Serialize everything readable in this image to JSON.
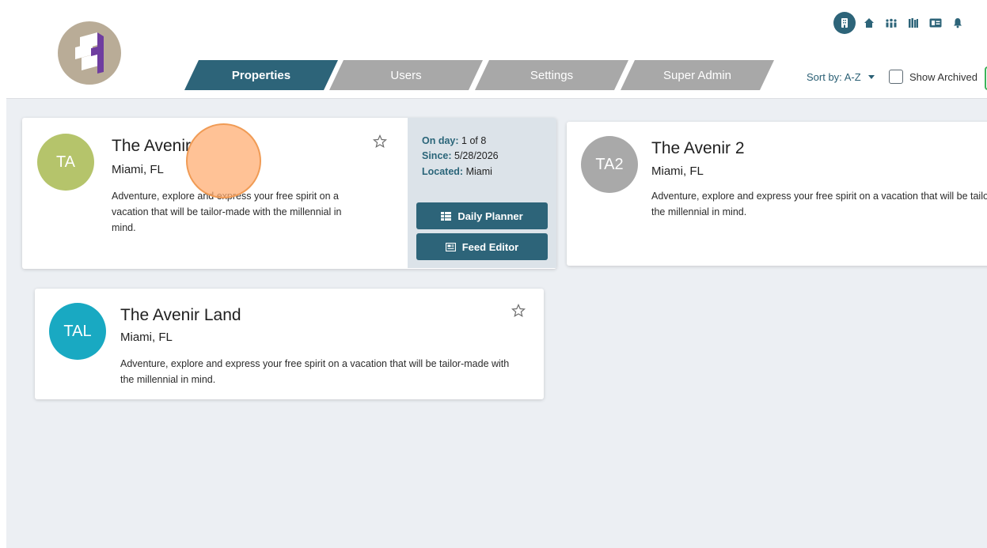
{
  "header": {
    "logo_icon": "brand-s-logo",
    "tabs": [
      {
        "label": "Properties",
        "active": true
      },
      {
        "label": "Users",
        "active": false
      },
      {
        "label": "Settings",
        "active": false
      },
      {
        "label": "Super Admin",
        "active": false
      }
    ],
    "top_icons": [
      "building-icon",
      "home-icon",
      "group-icon",
      "library-icon",
      "id-card-icon",
      "bell-icon"
    ],
    "sort_label": "Sort by: A-Z",
    "show_archived_label": "Show Archived",
    "show_archived_checked": false
  },
  "properties": [
    {
      "initials": "TA",
      "name": "The Avenir",
      "location": "Miami, FL",
      "description_lines": [
        "Adventure, explore and express your free spirit on a",
        "vacation that will be tailor-made with the millennial in",
        "mind."
      ],
      "avatar_color": "#b5c46b",
      "favorite": false,
      "details": {
        "on_day_label": "On day:",
        "on_day_value": "1 of 8",
        "since_label": "Since:",
        "since_value": "5/28/2026",
        "located_label": "Located:",
        "located_value": "Miami"
      },
      "actions": [
        "Daily Planner",
        "Feed Editor"
      ]
    },
    {
      "initials": "TA2",
      "name": "The Avenir 2",
      "location": "Miami, FL",
      "description_lines": [
        "Adventure, explore and express your free spirit on a vacation that will be tailor-made with",
        "the millennial in mind."
      ],
      "avatar_color": "#a9a9a9"
    },
    {
      "initials": "TAL",
      "name": "The Avenir Land",
      "location": "Miami, FL",
      "description_lines": [
        "Adventure, explore and express your free spirit on a vacation that will be tailor-made with",
        "the millennial in mind."
      ],
      "avatar_color": "#19a9c2",
      "favorite": false
    }
  ],
  "colors": {
    "primary": "#2d6479",
    "tab_inactive": "#a8a8a8",
    "background": "#eceff3",
    "click_indicator": "#ffaa6e"
  }
}
